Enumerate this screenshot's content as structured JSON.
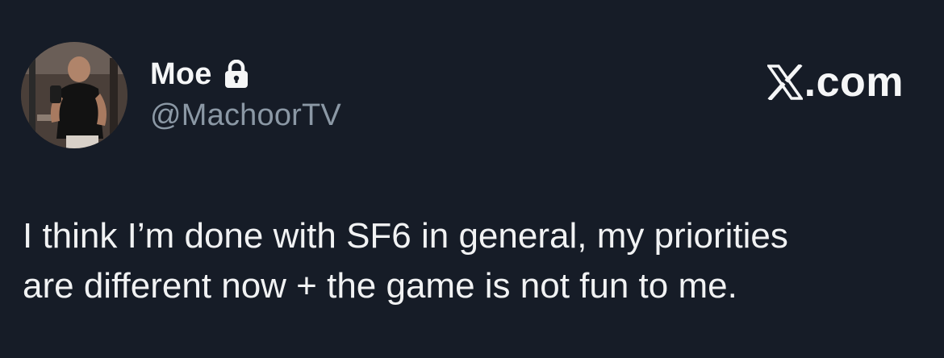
{
  "tweet": {
    "display_name": "Moe",
    "handle": "@MachoorTV",
    "text": "I think I’m done with SF6 in general, my priorities\nare different now + the game is not fun to me.",
    "protected": true
  },
  "brand": {
    "logo_icon": "x-logo-icon",
    "label": ".com"
  },
  "icons": {
    "lock": "lock-icon",
    "avatar": "avatar-photo"
  },
  "colors": {
    "background": "#161c27",
    "primary_text": "#f1f2f3",
    "secondary_text": "#8b98a5"
  }
}
